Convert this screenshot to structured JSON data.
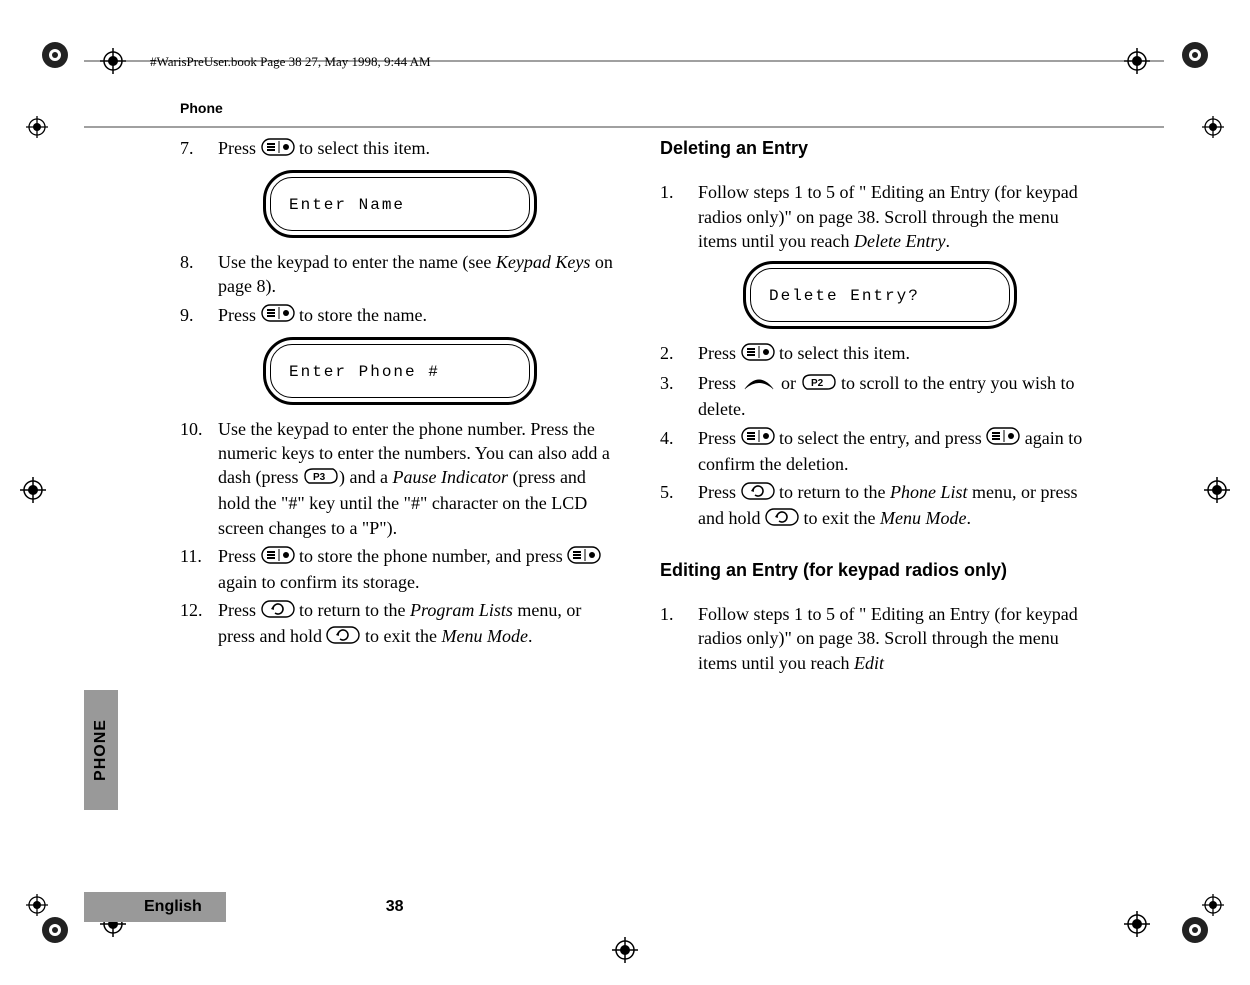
{
  "print_meta": "#WarisPreUser.book  Page 38  27, May 1998,   9:44 AM",
  "header_running": "Phone",
  "sidebar_tab": "PHONE",
  "footer_lang": "English",
  "footer_page": "38",
  "lcd1": "Enter Name",
  "lcd2": "Enter Phone #",
  "lcd3": "Delete Entry?",
  "left": {
    "s7_a": "Press ",
    "s7_b": " to select this item.",
    "s8_a": "Use the keypad to enter the name (see ",
    "s8_i": "Keypad Keys",
    "s8_b": " on page 8).",
    "s9_a": "Press ",
    "s9_b": " to store the name.",
    "s10_a": "Use the keypad to enter the phone number. Press the numeric keys to enter the numbers. You can also add a dash (press ",
    "s10_b": ") and a ",
    "s10_i": "Pause Indicator",
    "s10_c": " (press and hold the \"#\" key until the \"#\" character on the LCD screen changes to a \"P\").",
    "s11_a": "Press ",
    "s11_b": " to store the phone number, and press ",
    "s11_c": " again to confirm its storage.",
    "s12_a": "Press ",
    "s12_b": " to return to the ",
    "s12_i1": "Program Lists",
    "s12_c": " menu, or press and hold ",
    "s12_d": " to exit the ",
    "s12_i2": "Menu Mode",
    "s12_e": "."
  },
  "right": {
    "h1": "Deleting an Entry",
    "d1_a": "Follow steps 1 to 5 of \" Editing an Entry (for keypad radios only)\"  on page 38. Scroll through the menu items until you reach ",
    "d1_i": "Delete Entry",
    "d1_b": ".",
    "d2_a": "Press ",
    "d2_b": " to select this item.",
    "d3_a": "Press ",
    "d3_b": " or ",
    "d3_c": " to scroll to the entry you wish to delete.",
    "d4_a": "Press ",
    "d4_b": " to select the entry, and press ",
    "d4_c": " again to confirm the deletion.",
    "d5_a": "Press ",
    "d5_b": " to return to the ",
    "d5_i1": "Phone List",
    "d5_c": " menu, or press and hold ",
    "d5_d": " to exit the ",
    "d5_i2": "Menu Mode",
    "d5_e": ".",
    "h2": "Editing an Entry (for keypad radios only)",
    "e1_a": "Follow steps 1 to 5 of \" Editing an Entry (for keypad radios only)\"  on page 38. Scroll through the menu items until you reach ",
    "e1_i": "Edit"
  }
}
